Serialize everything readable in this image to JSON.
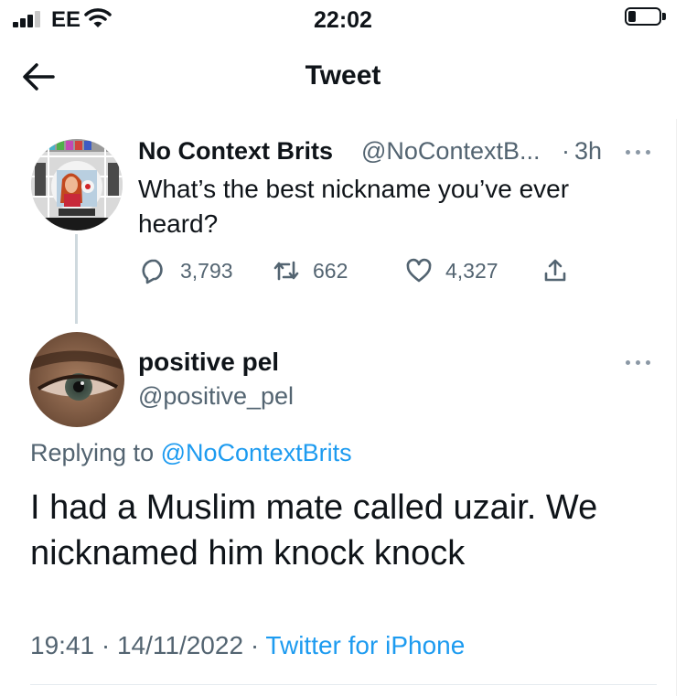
{
  "status_bar": {
    "carrier": "EE",
    "time": "22:02"
  },
  "header": {
    "title": "Tweet"
  },
  "quoted_tweet": {
    "display_name": "No Context Brits",
    "handle": "@NoContextB...",
    "separator": "·",
    "age": "3h",
    "text": "What’s the best nickname you’ve ever heard?",
    "replies": "3,793",
    "retweets": "662",
    "likes": "4,327"
  },
  "reply": {
    "display_name": "positive pel",
    "handle": "@positive_pel",
    "replying_prefix": "Replying to",
    "replying_to": "@NoContextBrits",
    "text": "I had a Muslim mate called uzair. We nicknamed him knock knock",
    "time": "19:41",
    "date": "14/11/2022",
    "separator": "·",
    "source": "Twitter for iPhone"
  },
  "colors": {
    "link": "#1d9bf0",
    "secondary_text": "#536471",
    "primary_text": "#0f1419"
  },
  "icons": [
    "signal-icon",
    "wifi-icon",
    "battery-icon",
    "back-arrow-icon",
    "more-icon",
    "reply-icon",
    "retweet-icon",
    "like-icon",
    "share-icon"
  ]
}
